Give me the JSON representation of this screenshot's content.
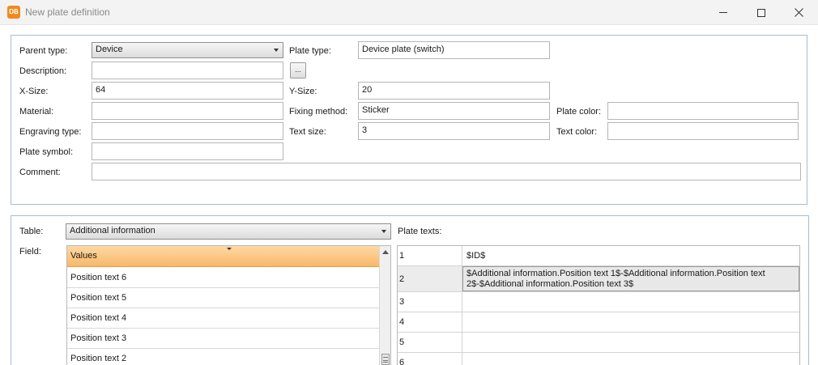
{
  "window": {
    "app_icon_text": "DB",
    "title": "New plate definition"
  },
  "plate": {
    "parent_type_label": "Parent type:",
    "parent_type_value": "Device",
    "plate_type_label": "Plate type:",
    "plate_type_value": "Device plate (switch)",
    "description_label": "Description:",
    "description_value": "",
    "ellipsis_label": "...",
    "xsize_label": "X-Size:",
    "xsize_value": "64",
    "ysize_label": "Y-Size:",
    "ysize_value": "20",
    "material_label": "Material:",
    "material_value": "",
    "fixing_label": "Fixing method:",
    "fixing_value": "Sticker",
    "plate_color_label": "Plate color:",
    "plate_color_value": "",
    "engraving_label": "Engraving type:",
    "engraving_value": "",
    "text_size_label": "Text size:",
    "text_size_value": "3",
    "text_color_label": "Text color:",
    "text_color_value": "",
    "symbol_label": "Plate symbol:",
    "symbol_value": "",
    "comment_label": "Comment:",
    "comment_value": ""
  },
  "texts": {
    "table_label": "Table:",
    "table_value": "Additional information",
    "plate_texts_label": "Plate texts:",
    "field_label": "Field:",
    "field_header": "Values",
    "field_items": [
      "Position text 6",
      "Position text 5",
      "Position text 4",
      "Position text 3",
      "Position text 2"
    ],
    "rows": [
      {
        "num": "1",
        "text": "$ID$"
      },
      {
        "num": "2",
        "text": "$Additional information.Position text 1$-$Additional information.Position text 2$-$Additional information.Position text 3$"
      },
      {
        "num": "3",
        "text": ""
      },
      {
        "num": "4",
        "text": ""
      },
      {
        "num": "5",
        "text": ""
      },
      {
        "num": "6",
        "text": ""
      }
    ]
  },
  "colors": {
    "accent": "#f08a1c",
    "group_border": "#a8bccf",
    "header_orange": "#f8b868"
  }
}
